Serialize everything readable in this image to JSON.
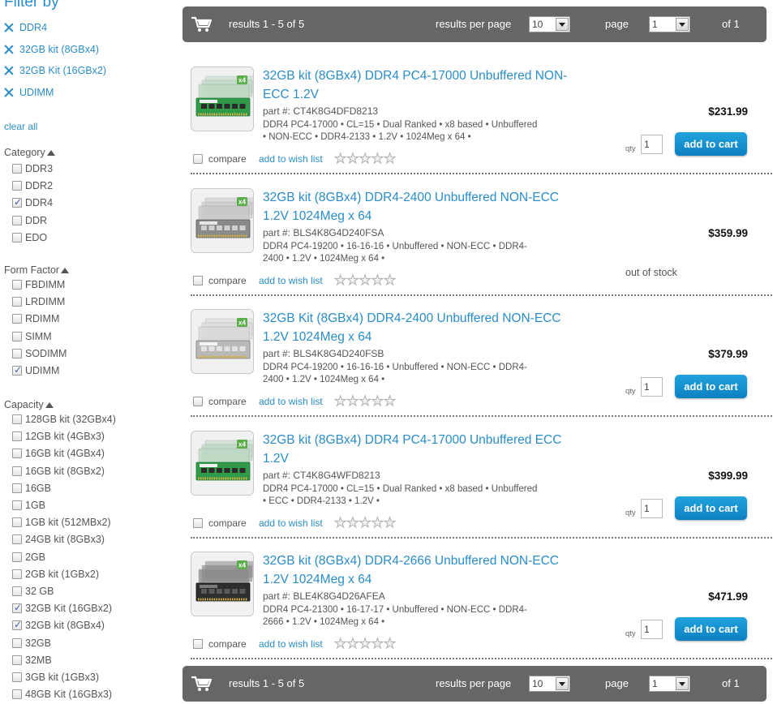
{
  "sidebar": {
    "filter_title": "Filter by",
    "active_filters": [
      "DDR4",
      "32GB kit (8GBx4)",
      "32GB Kit (16GBx2)",
      "UDIMM"
    ],
    "clear_all": "clear all",
    "category": {
      "title": "Category",
      "options": [
        {
          "label": "DDR3",
          "checked": false
        },
        {
          "label": "DDR2",
          "checked": false
        },
        {
          "label": "DDR4",
          "checked": true
        },
        {
          "label": "DDR",
          "checked": false
        },
        {
          "label": "EDO",
          "checked": false
        }
      ]
    },
    "form_factor": {
      "title": "Form Factor",
      "options": [
        {
          "label": "FBDIMM",
          "checked": false
        },
        {
          "label": "LRDIMM",
          "checked": false
        },
        {
          "label": "RDIMM",
          "checked": false
        },
        {
          "label": "SIMM",
          "checked": false
        },
        {
          "label": "SODIMM",
          "checked": false
        },
        {
          "label": "UDIMM",
          "checked": true
        }
      ]
    },
    "capacity": {
      "title": "Capacity",
      "options": [
        {
          "label": "128GB kit (32GBx4)",
          "checked": false
        },
        {
          "label": "12GB kit (4GBx3)",
          "checked": false
        },
        {
          "label": "16GB kit (4GBx4)",
          "checked": false
        },
        {
          "label": "16GB kit (8GBx2)",
          "checked": false
        },
        {
          "label": "16GB",
          "checked": false
        },
        {
          "label": "1GB",
          "checked": false
        },
        {
          "label": "1GB kit (512MBx2)",
          "checked": false
        },
        {
          "label": "24GB kit (8GBx3)",
          "checked": false
        },
        {
          "label": "2GB",
          "checked": false
        },
        {
          "label": "2GB kit (1GBx2)",
          "checked": false
        },
        {
          "label": "32 GB",
          "checked": false
        },
        {
          "label": "32GB Kit (16GBx2)",
          "checked": true
        },
        {
          "label": "32GB kit (8GBx4)",
          "checked": true
        },
        {
          "label": "32GB",
          "checked": false
        },
        {
          "label": "32MB",
          "checked": false
        },
        {
          "label": "3GB kit (1GBx3)",
          "checked": false
        },
        {
          "label": "48GB Kit (16GBx3)",
          "checked": false
        }
      ]
    }
  },
  "results_bar": {
    "count_text": "results 1 - 5 of 5",
    "per_page_label": "results per page",
    "per_page_value": "10",
    "page_label": "page",
    "page_value": "1",
    "of_text": "of 1"
  },
  "product_common": {
    "qty_label": "qty",
    "qty_value": "1",
    "add_to_cart": "add to cart",
    "compare": "compare",
    "wishlist": "add to wish list",
    "out_of_stock": "out of stock",
    "star_glyph": "★"
  },
  "products": [
    {
      "title": "32GB kit (8GBx4) DDR4 PC4-17000 Unbuffered NON-ECC 1.2V",
      "part": "part #: CT4K8G4DFD8213",
      "desc": "DDR4 PC4-17000 • CL=15 • Dual Ranked • x8 based • Unbuffered • NON-ECC • DDR4-2133 • 1.2V • 1024Meg x 64 •",
      "price": "$231.99",
      "in_stock": true,
      "image_style": "green",
      "rating": 0
    },
    {
      "title": "32GB kit (8GBx4) DDR4-2400 Unbuffered NON-ECC 1.2V 1024Meg x 64",
      "part": "part #: BLS4K8G4D240FSA",
      "desc": "DDR4 PC4-19200 • 16-16-16 • Unbuffered • NON-ECC • DDR4-2400 • 1.2V • 1024Meg x 64 •",
      "price": "$359.99",
      "in_stock": false,
      "image_style": "gray",
      "rating": 0
    },
    {
      "title": "32GB Kit (8GBx4) DDR4-2400 Unbuffered NON-ECC 1.2V 1024Meg x 64",
      "part": "part #: BLS4K8G4D240FSB",
      "desc": "DDR4 PC4-19200 • 16-16-16 • Unbuffered • NON-ECC • DDR4-2400 • 1.2V • 1024Meg x 64 •",
      "price": "$379.99",
      "in_stock": true,
      "image_style": "light",
      "rating": 0
    },
    {
      "title": "32GB kit (8GBx4) DDR4 PC4-17000 Unbuffered ECC 1.2V",
      "part": "part #: CT4K8G4WFD8213",
      "desc": "DDR4 PC4-17000 • CL=15 • Dual Ranked • x8 based • Unbuffered • ECC • DDR4-2133 • 1.2V •",
      "price": "$399.99",
      "in_stock": true,
      "image_style": "green",
      "rating": 0
    },
    {
      "title": "32GB kit (8GBx4) DDR4-2666 Unbuffered NON-ECC 1.2V 1024Meg x 64",
      "part": "part #: BLE4K8G4D26AFEA",
      "desc": "DDR4 PC4-21300 • 16-17-17 • Unbuffered • NON-ECC • DDR4-2666 • 1.2V • 1024Meg x 64 •",
      "price": "$471.99",
      "in_stock": true,
      "image_style": "dark",
      "rating": 0
    }
  ]
}
